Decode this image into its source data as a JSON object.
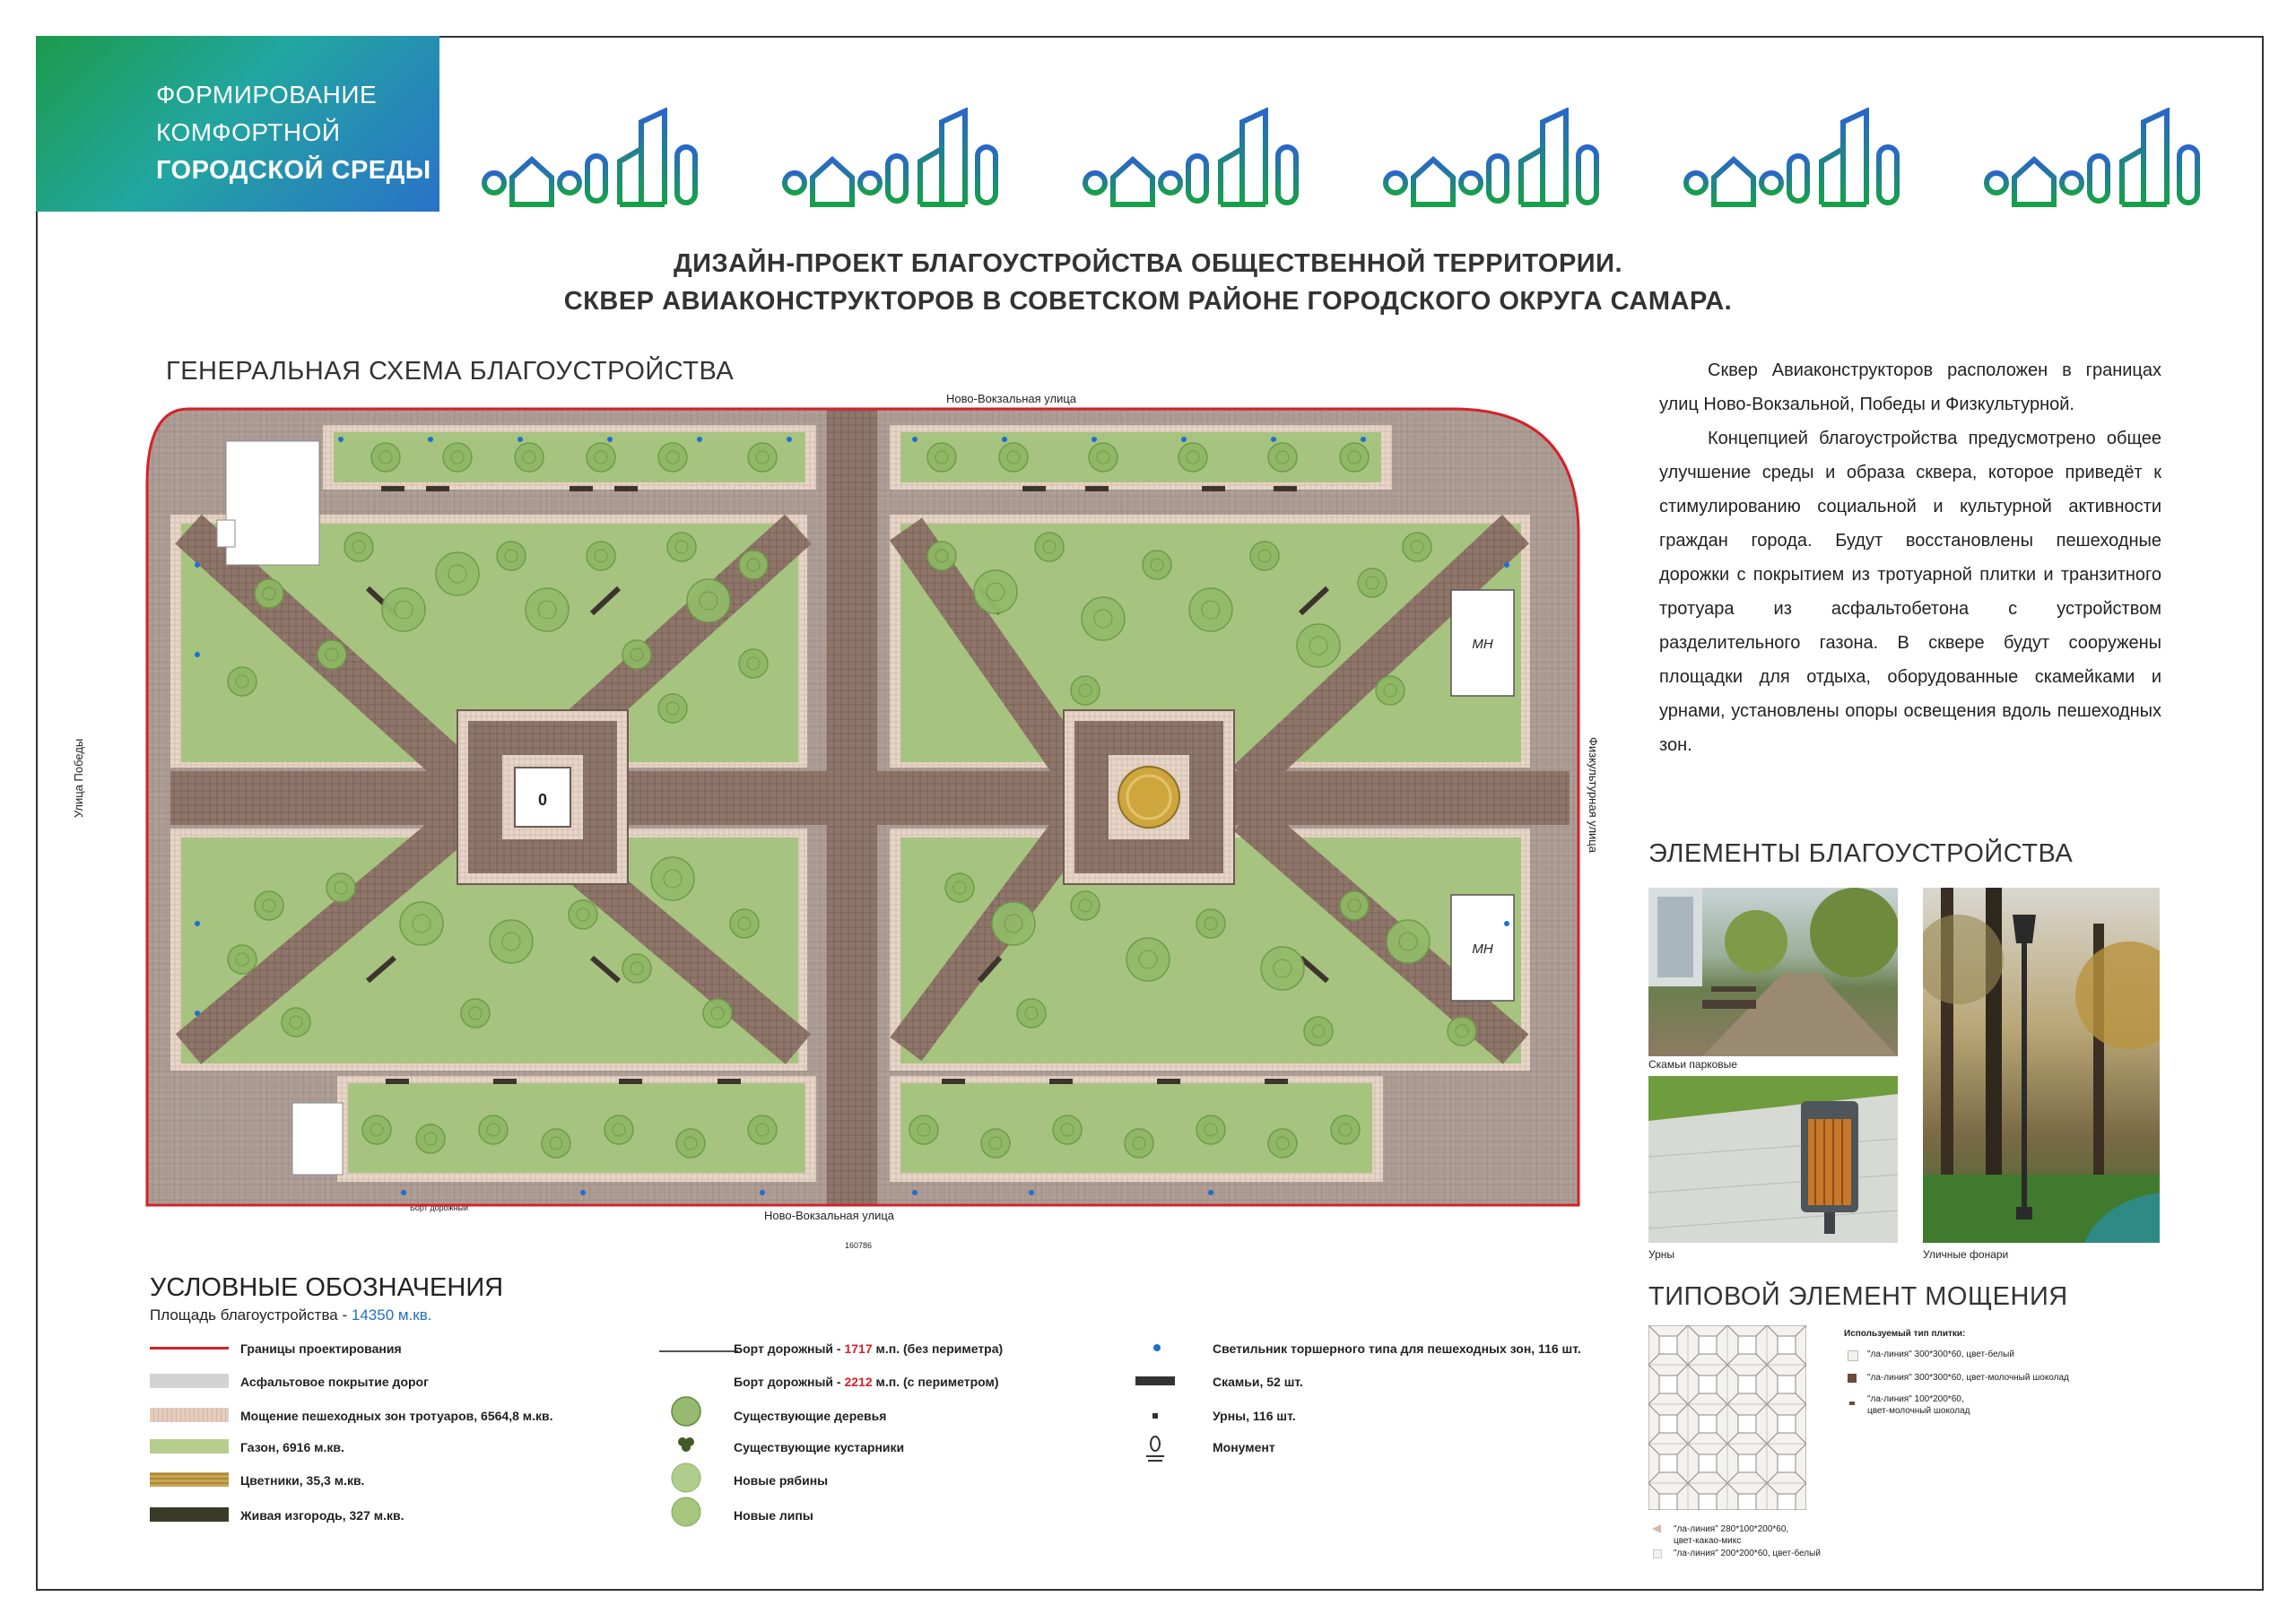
{
  "brand": {
    "line1": "ФОРМИРОВАНИЕ",
    "line2": "КОМФОРТНОЙ",
    "line3": "ГОРОДСКОЙ СРЕДЫ"
  },
  "colors": {
    "red_border": "#d6202a",
    "lawn": "#a3bf7c",
    "tree": "#88b35e",
    "paving": "#8c7368",
    "asphalt": "#bdbdbd",
    "brand_green": "#1c9a4a",
    "brand_blue": "#2a72c8"
  },
  "title": {
    "line1": "ДИЗАЙН-ПРОЕКТ БЛАГОУСТРОЙСТВА ОБЩЕСТВЕННОЙ ТЕРРИТОРИИ.",
    "line2": "СКВЕР АВИАКОНСТРУКТОРОВ В СОВЕТСКОМ РАЙОНЕ ГОРОДСКОГО ОКРУГА САМАРА."
  },
  "plan": {
    "heading": "ГЕНЕРАЛЬНАЯ СХЕМА БЛАГОУСТРОЙСТВА",
    "street_top": "Ново-Вокзальная улица",
    "street_bottom": "Ново-Вокзальная улица",
    "street_left": "Улица Победы",
    "street_right": "Физкультурная улица",
    "curb_label": "Борт дорожный",
    "total_dim": "160786",
    "mn": "МН",
    "monument": "0"
  },
  "description": {
    "p1": "Сквер Авиаконструкторов расположен в границах улиц Ново-Вокзальной, Победы и Физкультурной.",
    "p2": "Концепцией благоустройства предусмотрено общее улучшение среды и образа сквера, которое приведёт к стимулированию социальной и культурной активности граждан города. Будут восстановлены пешеходные дорожки с покрытием из тротуарной плитки и транзитного тротуара из асфальтобетона с устройством разделительного газона. В сквере будут сооружены площадки для отдыха, оборудованные скамейками и урнами, установлены опоры освещения вдоль пешеходных зон."
  },
  "elements": {
    "heading": "ЭЛЕМЕНТЫ БЛАГОУСТРОЙСТВА",
    "benches": "Скамьи парковые",
    "urns": "Урны",
    "lamps": "Уличные фонари"
  },
  "legend": {
    "heading": "УСЛОВНЫЕ ОБОЗНАЧЕНИЯ",
    "area_label": "Площадь благоустройства -",
    "area_value": "14350 м.кв.",
    "col1": [
      "Границы проектирования",
      "Асфальтовое покрытие дорог",
      "Мощение пешеходных зон тротуаров, 6564,8 м.кв.",
      "Газон, 6916 м.кв.",
      "Цветники, 35,3 м.кв.",
      "Живая изгородь, 327 м.кв."
    ],
    "curb1_label": "Борт дорожный -",
    "curb1_num": "1717",
    "curb1_rest": "м.п. (без периметра)",
    "curb2_label": "Борт дорожный -",
    "curb2_num": "2212",
    "curb2_rest": "м.п. (с периметром)",
    "col2": [
      "Существующие деревья",
      "Существующие кустарники",
      "Новые рябины",
      "Новые липы"
    ],
    "col3": [
      "Светильник торшерного типа для пешеходных зон, 116 шт.",
      "Скамьи, 52 шт.",
      "Урны, 116 шт.",
      "Монумент"
    ]
  },
  "paving": {
    "heading": "ТИПОВОЙ ЭЛЕМЕНТ МОЩЕНИЯ",
    "used_title": "Используемый тип плитки:",
    "t1": "\"ла-линия\" 300*300*60, цвет-белый",
    "t2": "\"ла-линия\" 300*300*60, цвет-молочный шоколад",
    "t3a": "\"ла-линия\" 100*200*60,",
    "t3b": "цвет-молочный шоколад",
    "t4a": "\"ла-линия\" 280*100*200*60,",
    "t4b": "цвет-какао-микс",
    "t5": "\"ла-линия\" 200*200*60, цвет-белый"
  }
}
